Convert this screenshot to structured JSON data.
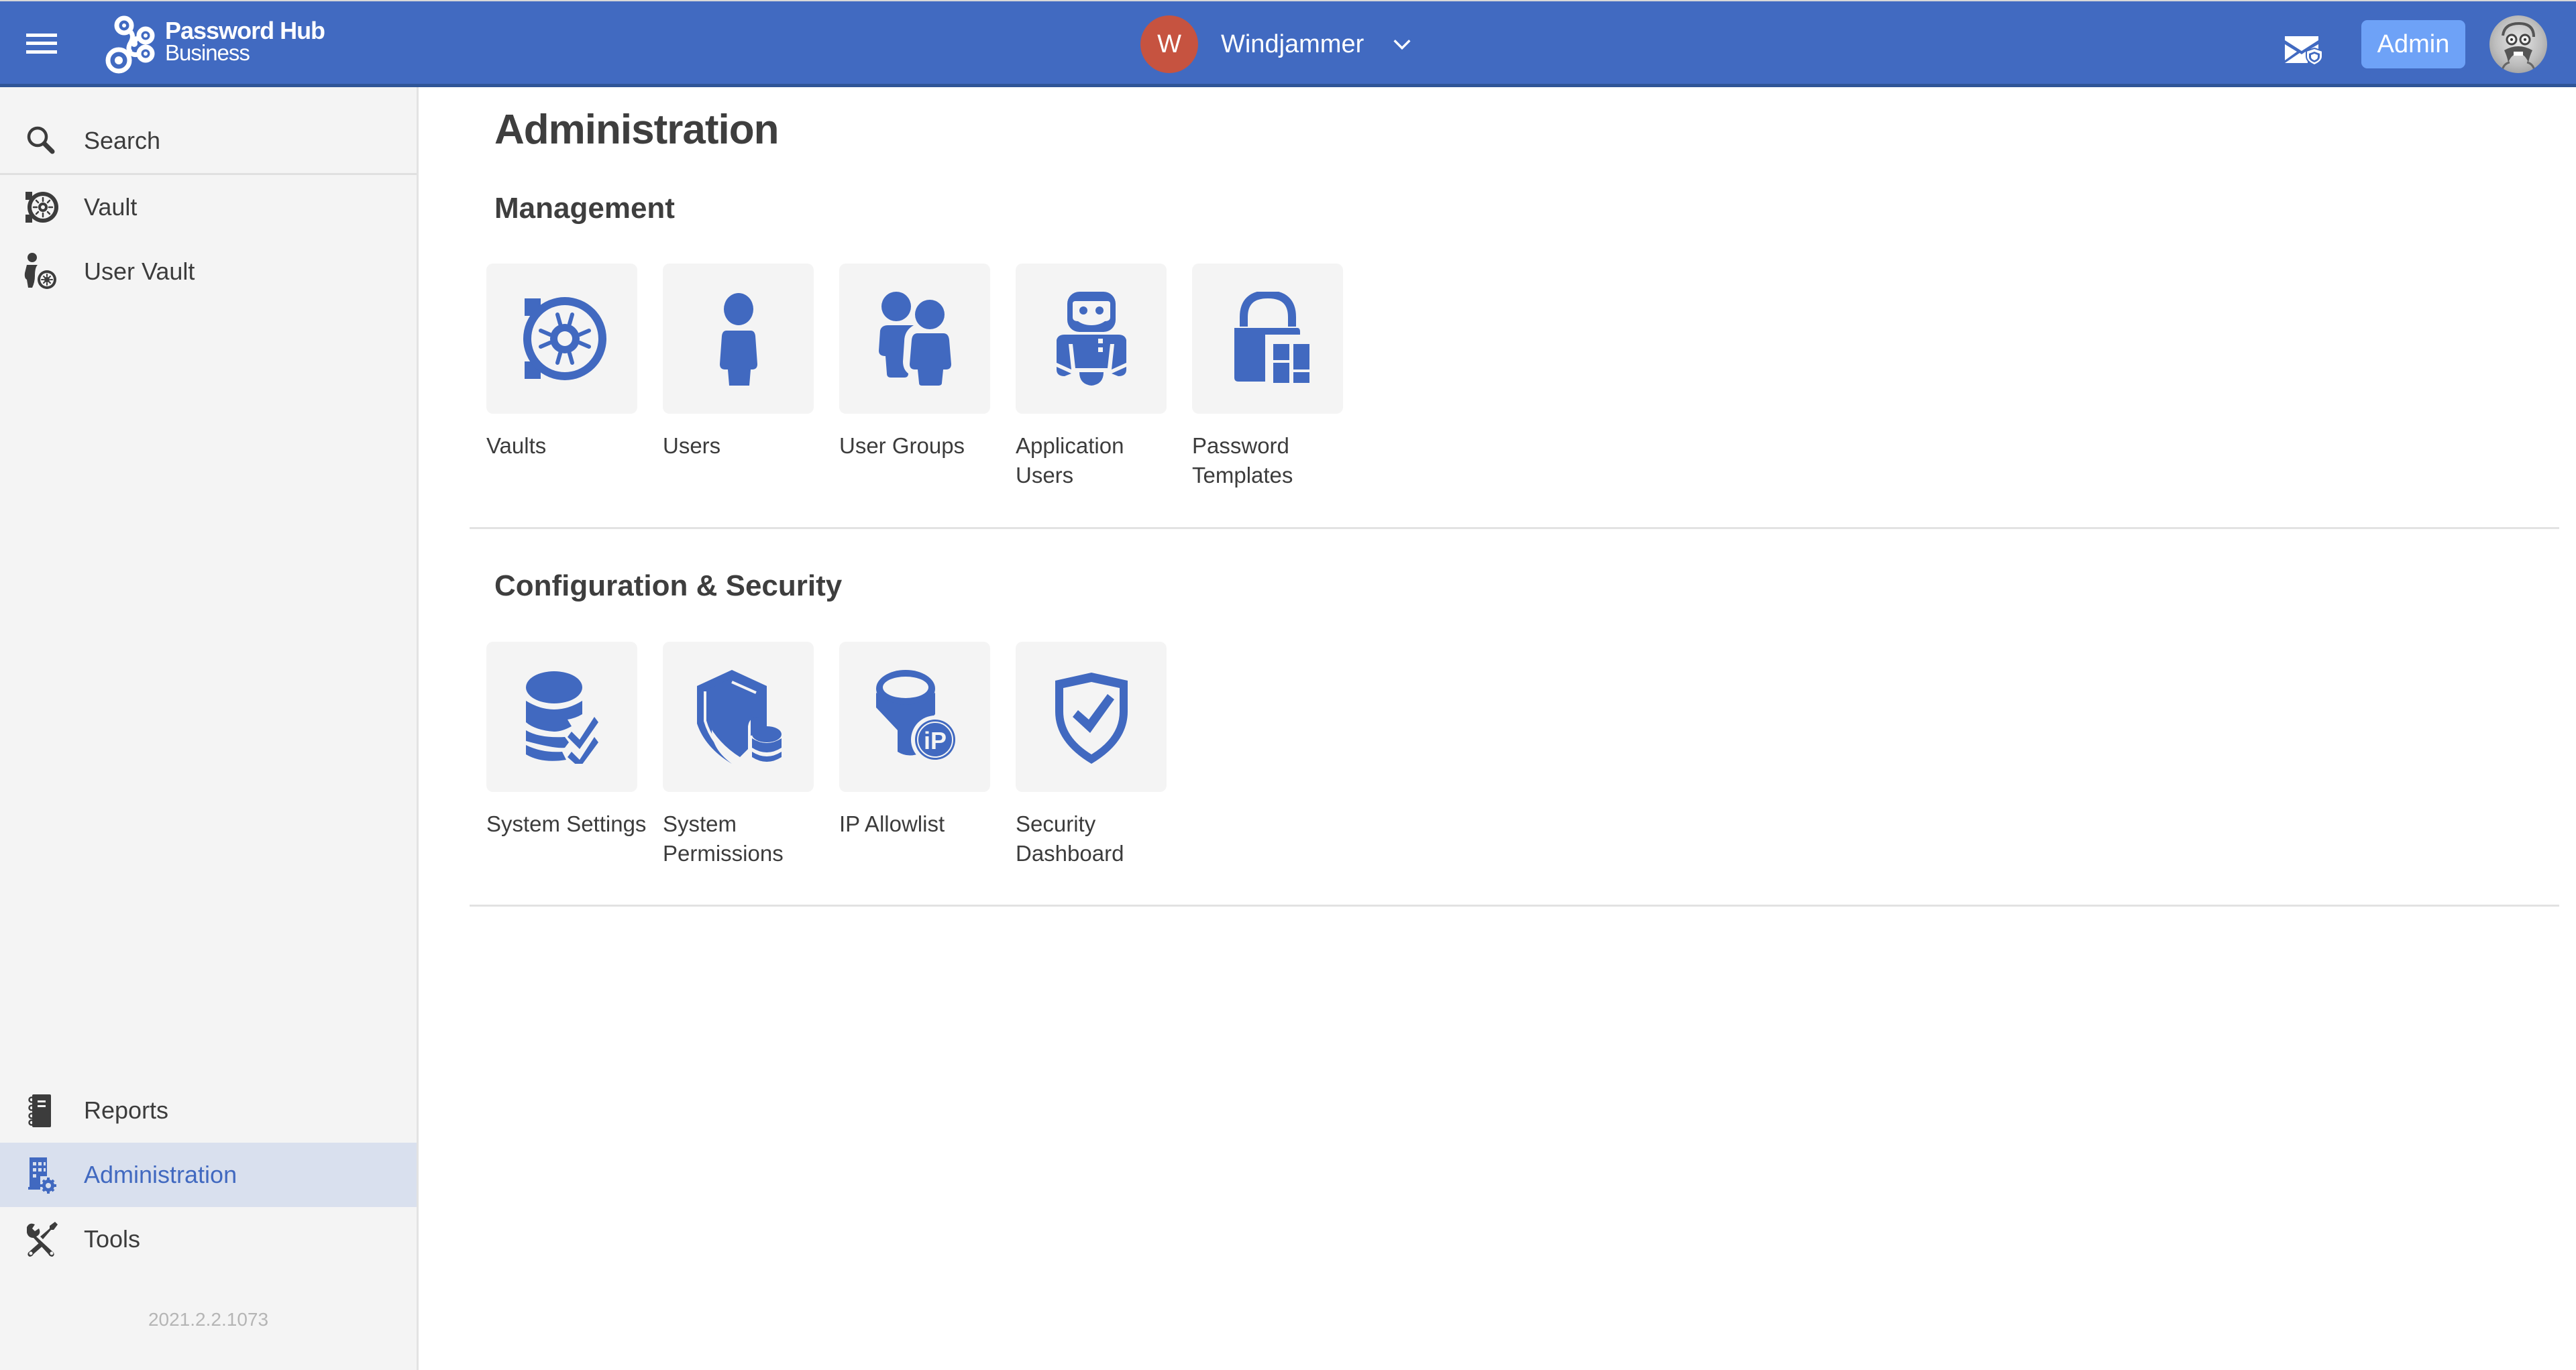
{
  "header": {
    "brand_line1": "Password Hub",
    "brand_line2": "Business",
    "tenant_initial": "W",
    "tenant_name": "Windjammer",
    "admin_label": "Admin",
    "colors": {
      "bar": "#416ac1",
      "tenant_avatar": "#c65340",
      "admin_button": "#6ea2f7"
    }
  },
  "sidebar": {
    "items": [
      {
        "label": "Search",
        "icon": "search-icon"
      },
      {
        "label": "Vault",
        "icon": "vault-icon"
      },
      {
        "label": "User Vault",
        "icon": "user-vault-icon"
      },
      {
        "label": "Reports",
        "icon": "reports-icon"
      },
      {
        "label": "Administration",
        "icon": "administration-icon",
        "active": true
      },
      {
        "label": "Tools",
        "icon": "tools-icon"
      }
    ],
    "version": "2021.2.2.1073"
  },
  "main": {
    "title": "Administration",
    "sections": [
      {
        "title": "Management",
        "tiles": [
          {
            "label": "Vaults",
            "icon": "vault-icon"
          },
          {
            "label": "Users",
            "icon": "user-icon"
          },
          {
            "label": "User Groups",
            "icon": "user-groups-icon"
          },
          {
            "label": "Application Users",
            "icon": "robot-icon"
          },
          {
            "label": "Password Templates",
            "icon": "lock-template-icon"
          }
        ]
      },
      {
        "title": "Configuration & Security",
        "tiles": [
          {
            "label": "System Settings",
            "icon": "database-check-icon"
          },
          {
            "label": "System Permissions",
            "icon": "shield-database-icon"
          },
          {
            "label": "IP Allowlist",
            "icon": "ip-filter-icon"
          },
          {
            "label": "Security Dashboard",
            "icon": "shield-check-icon"
          }
        ]
      }
    ],
    "accent_color": "#4169c0"
  }
}
